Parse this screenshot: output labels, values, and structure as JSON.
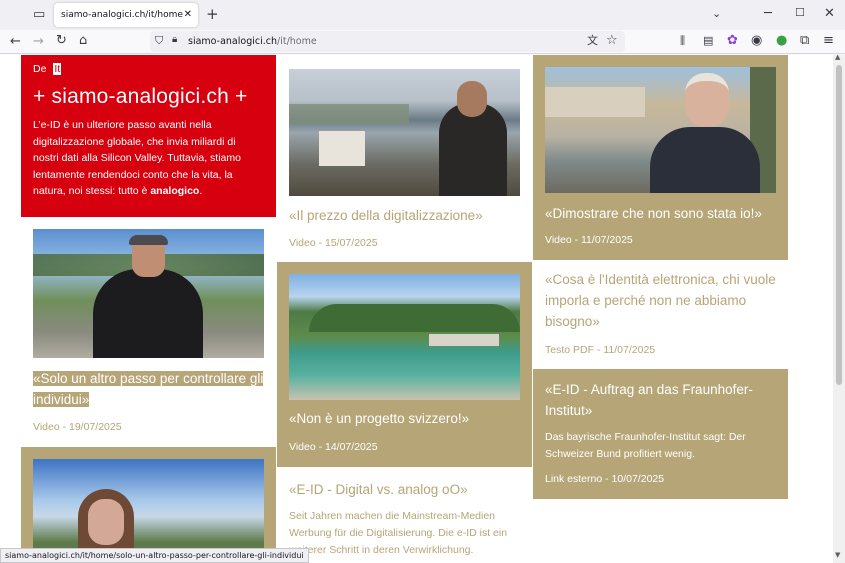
{
  "browser": {
    "tab_title": "siamo-analogici.ch/it/home",
    "url_domain": "siamo-analogici.ch",
    "url_path": "/it/home",
    "status_url": "siamo-analogici.ch/it/home/solo-un-altro-passo-per-controllare-gli-individui"
  },
  "header": {
    "lang_de": "De",
    "lang_it": "It",
    "site_title": "+ siamo-analogici.ch +",
    "intro": "L’e-ID è un ulteriore passo avanti nella digitalizzazione globale, che invia miliardi di nostri dati alla Silicon Valley. Tuttavia, stiamo lentamente rendendoci conto che la vita, la natura, noi stessi: tutto è ",
    "intro_bold": "analogico",
    "intro_end": "."
  },
  "posts": [
    {
      "title": "«Il prezzo della digitalizzazione»",
      "meta": "Video - 15/07/2025"
    },
    {
      "title": "«Dimostrare che non sono stata io!»",
      "meta": "Video - 11/07/2025"
    },
    {
      "title": "«Solo un altro passo per controllare gli individui»",
      "meta": "Video - 19/07/2025"
    },
    {
      "title": "«Non è un progetto svizzero!»",
      "meta": "Video - 14/07/2025"
    },
    {
      "title": "«Cosa è l'Identità elettronica, chi vuole imporla e perché non ne abbiamo bisogno»",
      "meta": "Testo PDF - 11/07/2025"
    },
    {
      "title": "«E-ID - Auftrag an das Fraunhofer-Institut»",
      "desc": "Das bayrische Fraunhofer-Institut sagt: Der Schweizer Bund profitiert wenig.",
      "meta": "Link esterno - 10/07/2025"
    },
    {
      "title": "«E-ID - Digital vs. analog oO»",
      "desc": "Seit Jahren machen die Mainstream-Medien Werbung für die Digitalisierung. Die e-ID ist ein weiterer Schritt in deren Verwirklichung."
    }
  ],
  "colors": {
    "red": "#d6000f",
    "gold": "#b6a577"
  }
}
